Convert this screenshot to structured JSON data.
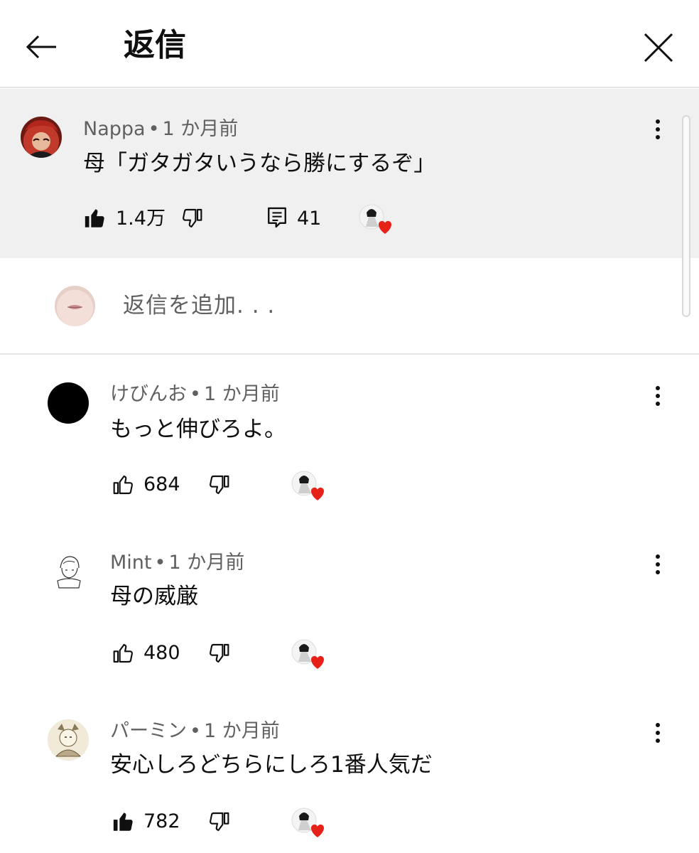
{
  "header": {
    "title": "返信"
  },
  "parent_comment": {
    "author": "Nappa",
    "age": "1 か月前",
    "text": "母「ガタガタいうなら勝にするぞ」",
    "likes": "1.4万",
    "replies": "41",
    "liked": true
  },
  "reply_input": {
    "placeholder": "返信を追加. . ."
  },
  "replies": [
    {
      "author": "けびんお",
      "age": "1 か月前",
      "text": "もっと伸びろよ。",
      "likes": "684",
      "liked": false
    },
    {
      "author": "Mint",
      "age": "1 か月前",
      "text": "母の威厳",
      "likes": "480",
      "liked": false
    },
    {
      "author": "パーミン",
      "age": "1 か月前",
      "text": "安心しろどちらにしろ1番人気だ",
      "likes": "782",
      "liked": true
    }
  ],
  "colors": {
    "heart": "#e62117",
    "parent_bg": "#f0f0f0",
    "secondary_text": "#606060"
  },
  "icons": {
    "back": "arrow-left-icon",
    "close": "close-icon",
    "like": "thumbs-up-icon",
    "dislike": "thumbs-down-icon",
    "reply": "comment-icon",
    "more": "more-vert-icon",
    "creator_heart": "heart-icon"
  }
}
